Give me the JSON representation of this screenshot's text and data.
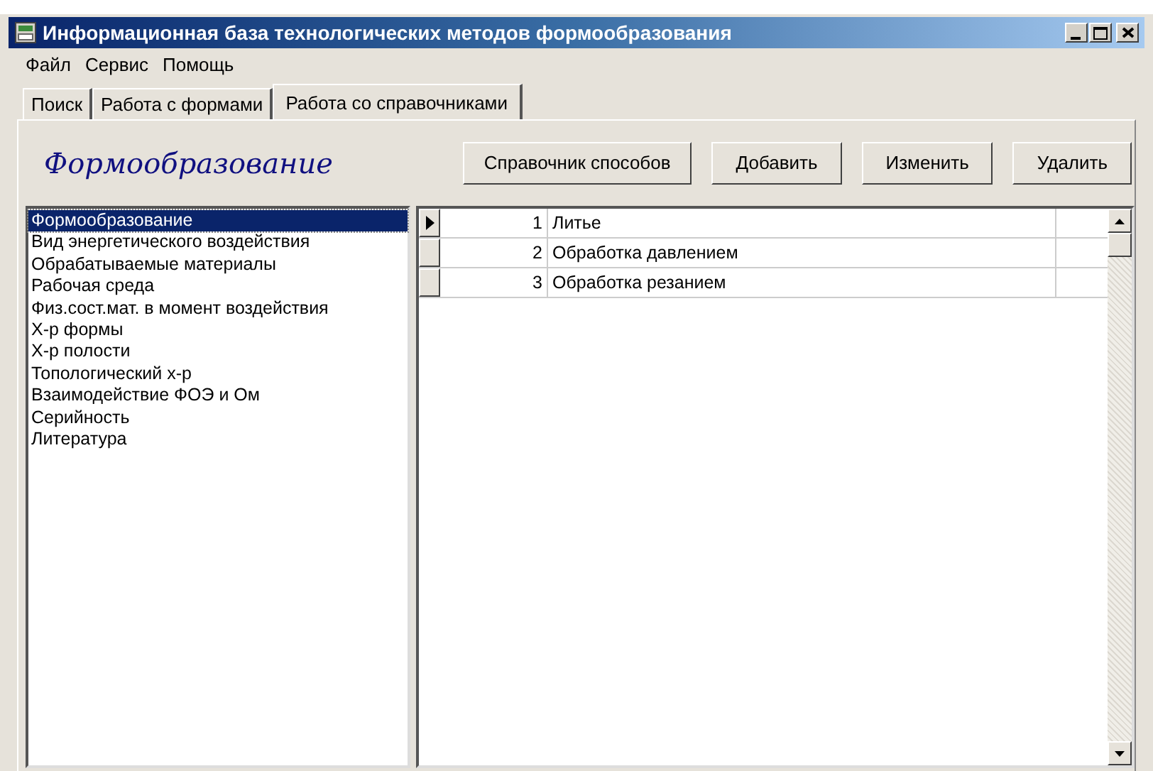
{
  "window": {
    "title": "Информационная база технологических методов формообразования"
  },
  "menu": [
    "Файл",
    "Сервис",
    "Помощь"
  ],
  "tabs": [
    {
      "label": "Поиск",
      "selected": false
    },
    {
      "label": "Работа с формами",
      "selected": false
    },
    {
      "label": "Работа со справочниками",
      "selected": true
    }
  ],
  "heading": "Формообразование",
  "buttons": [
    "Справочник способов",
    "Добавить",
    "Изменить",
    "Удалить"
  ],
  "list": [
    {
      "label": "Формообразование",
      "selected": true
    },
    {
      "label": "Вид энергетического воздействия",
      "selected": false
    },
    {
      "label": "Обрабатываемые материалы",
      "selected": false
    },
    {
      "label": "Рабочая среда",
      "selected": false
    },
    {
      "label": "Физ.сост.мат. в момент воздействия",
      "selected": false
    },
    {
      "label": "Х-р формы",
      "selected": false
    },
    {
      "label": "Х-р полости",
      "selected": false
    },
    {
      "label": "Топологический х-р",
      "selected": false
    },
    {
      "label": "Взаимодействие ФОЭ и Ом",
      "selected": false
    },
    {
      "label": "Серийность",
      "selected": false
    },
    {
      "label": "Литература",
      "selected": false
    }
  ],
  "table": {
    "rows": [
      {
        "number": "1",
        "name": "Литье",
        "selected": true
      },
      {
        "number": "2",
        "name": "Обработка давлением",
        "selected": false
      },
      {
        "number": "3",
        "name": "Обработка резанием",
        "selected": false
      }
    ]
  }
}
